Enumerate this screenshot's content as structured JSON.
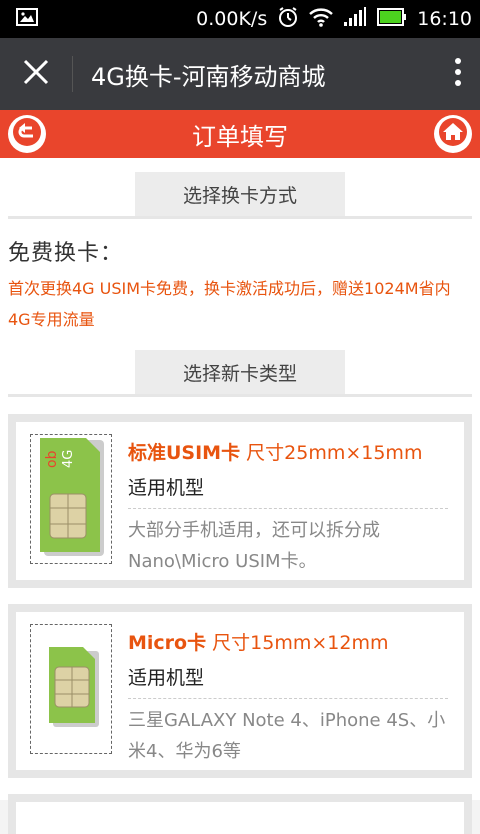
{
  "statusbar": {
    "speed": "0.00K/s",
    "time": "16:10"
  },
  "titlebar": {
    "title": "4G换卡-河南移动商城"
  },
  "header": {
    "title": "订单填写"
  },
  "sections": {
    "method_tab": "选择换卡方式",
    "free_title": "免费换卡：",
    "free_desc": "首次更换4G USIM卡免费，换卡激活成功后，赠送1024M省内4G专用流量",
    "type_tab": "选择新卡类型"
  },
  "cards": [
    {
      "name": "标准USIM卡",
      "size": "尺寸25mm×15mm",
      "sub": "适用机型",
      "desc": "大部分手机适用，还可以拆分成Nano\\Micro USIM卡。"
    },
    {
      "name": "Micro卡",
      "size": "尺寸15mm×12mm",
      "sub": "适用机型",
      "desc": "三星GALAXY Note 4、iPhone 4S、小米4、华为6等"
    }
  ],
  "colors": {
    "accent": "#e9452c",
    "highlight": "#e8540f",
    "titlebar": "#393a3e"
  }
}
